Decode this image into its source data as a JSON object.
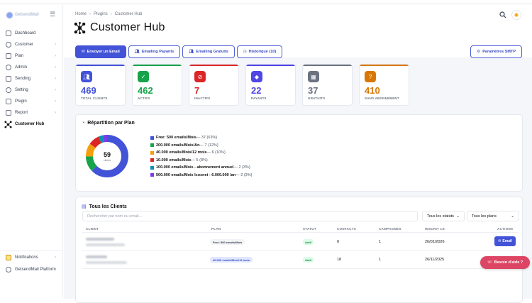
{
  "app": {
    "brand_label": "GetsendMail"
  },
  "sidebar": {
    "items": [
      {
        "label": "Dashboard",
        "icon": "dashboard-icon",
        "chevron": false
      },
      {
        "label": "Customer",
        "icon": "customer-icon",
        "chevron": true
      },
      {
        "label": "Plan",
        "icon": "plan-icon",
        "chevron": true
      },
      {
        "label": "Admin",
        "icon": "admin-icon",
        "chevron": true
      },
      {
        "label": "Sending",
        "icon": "sending-icon",
        "chevron": true
      },
      {
        "label": "Setting",
        "icon": "setting-icon",
        "chevron": true
      },
      {
        "label": "Plugin",
        "icon": "plugin-icon",
        "chevron": true
      },
      {
        "label": "Report",
        "icon": "report-icon",
        "chevron": true
      },
      {
        "label": "Customer Hub",
        "icon": "hub-icon",
        "chevron": false
      }
    ],
    "bottom": [
      {
        "label": "Notifications",
        "icon": "notifications-icon"
      },
      {
        "label": "GetsendMail Platform",
        "icon": "platform-icon"
      }
    ]
  },
  "header": {
    "breadcrumb": [
      "Home",
      "Plugins",
      "Customer Hub"
    ],
    "title": "Customer Hub"
  },
  "tabs": [
    {
      "label": "Envoyer un Email",
      "icon": "mail-icon",
      "primary": true
    },
    {
      "label": "Emailing Payants",
      "icon": "users-icon",
      "primary": false
    },
    {
      "label": "Emailing Gratuits",
      "icon": "users-icon",
      "primary": false
    },
    {
      "label": "Historique (10)",
      "icon": "history-icon",
      "primary": false
    }
  ],
  "smtp_button": "Paramètres SMTP",
  "stats": [
    {
      "value": "469",
      "label": "TOTAL CLIENTS",
      "color": "#4353d8",
      "icon": "users-icon"
    },
    {
      "value": "462",
      "label": "ACTIFS",
      "color": "#16a34a",
      "icon": "check-icon"
    },
    {
      "value": "7",
      "label": "INACTIFS",
      "color": "#dc2626",
      "icon": "block-icon"
    },
    {
      "value": "22",
      "label": "PAYANTS",
      "color": "#4f46e5",
      "icon": "diamond-icon"
    },
    {
      "value": "37",
      "label": "GRATUITS",
      "color": "#6b7280",
      "icon": "gift-icon"
    },
    {
      "value": "410",
      "label": "SANS ABONNEMENT",
      "color": "#d97706",
      "icon": "question-icon"
    }
  ],
  "distribution": {
    "title": "Répartition par Plan",
    "total": "59",
    "total_label": "clients",
    "items": [
      {
        "label": "Free: 500 emails/Mois",
        "detail": " — 37 (63%)",
        "color": "#4353d8",
        "value": 37
      },
      {
        "label": "200.000 emails/Mois/An",
        "detail": " — 7 (12%)",
        "color": "#16a34a",
        "value": 7
      },
      {
        "label": "40.000 emails/Mois/12 mois",
        "detail": " — 6 (10%)",
        "color": "#f59e0b",
        "value": 6
      },
      {
        "label": "10.000 emails/Mois",
        "detail": " — 5 (8%)",
        "color": "#dc2626",
        "value": 5
      },
      {
        "label": "100.000 emails/Mois - abonnement annuel",
        "detail": " — 2 (3%)",
        "color": "#0891b2",
        "value": 2
      },
      {
        "label": "500.000 emails/Mois Icosnet - 6.000.000 /an",
        "detail": " — 2 (3%)",
        "color": "#7c3aed",
        "value": 2
      }
    ]
  },
  "clients": {
    "title": "Tous les Clients",
    "search_placeholder": "Rechercher par nom ou email...",
    "status_filter": "Tous les statuts",
    "plan_filter": "Tous les plans",
    "columns": [
      "CLIENT",
      "PLAN",
      "STATUT",
      "CONTACTS",
      "CAMPAGNES",
      "INSCRIT LE",
      "ACTIONS"
    ],
    "rows": [
      {
        "plan": "Free: 500 emails/Mois",
        "plan_bg": "#f3f4f6",
        "plan_fg": "#374151",
        "status": "Actif",
        "contacts": "0",
        "campaigns": "1",
        "date": "26/01/2026",
        "action": "Email"
      },
      {
        "plan": "40.000 emails/Mois/12 mois",
        "plan_bg": "#e0e7ff",
        "plan_fg": "#3b4cc4",
        "status": "Actif",
        "contacts": "18",
        "campaigns": "1",
        "date": "26/11/2025",
        "action": "Email"
      }
    ]
  },
  "help_button": "Besoin d'aide ?"
}
